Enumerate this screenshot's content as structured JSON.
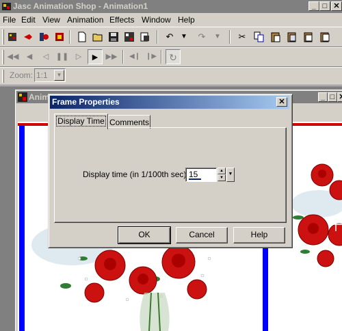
{
  "app": {
    "title": "Jasc Animation Shop - Animation1",
    "window_buttons": [
      "_",
      "□",
      "✕"
    ]
  },
  "menu": [
    "File",
    "Edit",
    "View",
    "Animation",
    "Effects",
    "Window",
    "Help"
  ],
  "zoom": {
    "label": "Zoom:",
    "value": "1:1"
  },
  "animation_window": {
    "title": "Animation1 [1:1] - Frame"
  },
  "dialog": {
    "title": "Frame Properties",
    "tabs": [
      "Display Time",
      "Comments"
    ],
    "field_label": "Display time (in 1/100th sec):",
    "field_value": "15",
    "buttons": {
      "ok": "OK",
      "cancel": "Cancel",
      "help": "Help"
    }
  },
  "colors": {
    "dialog_title_start": "#0a246a",
    "dialog_title_end": "#a6caf0",
    "frame_border": "#0000ff",
    "rose": "#cc0000"
  }
}
